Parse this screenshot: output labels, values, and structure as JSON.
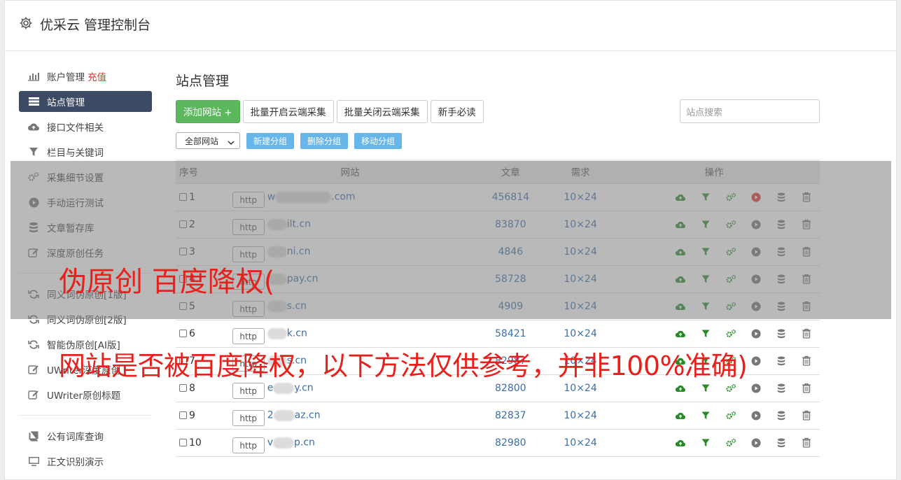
{
  "header": {
    "title": "优采云 管理控制台"
  },
  "sidebar": {
    "items": [
      {
        "label": "账户管理",
        "extra": "充值",
        "icon": "bar-chart-icon"
      },
      {
        "label": "站点管理",
        "icon": "server-icon",
        "active": true
      },
      {
        "label": "接口文件相关",
        "icon": "cloud-upload-icon"
      },
      {
        "label": "栏目与关键词",
        "icon": "filter-icon"
      },
      {
        "label": "采集细节设置",
        "icon": "gears-icon"
      },
      {
        "label": "手动运行测试",
        "icon": "play-circle-icon"
      },
      {
        "label": "文章暂存库",
        "icon": "database-icon"
      },
      {
        "label": "深度原创任务",
        "icon": "edit-icon"
      }
    ],
    "items2": [
      {
        "label": "同义词伪原创[1版]",
        "icon": "refresh-icon"
      },
      {
        "label": "同义词伪原创[2版]",
        "icon": "refresh-icon"
      },
      {
        "label": "智能伪原创[AI版]",
        "icon": "refresh-icon"
      },
      {
        "label": "UWriter深度原创",
        "icon": "edit-icon"
      },
      {
        "label": "UWriter原创标题",
        "icon": "edit-icon"
      }
    ],
    "items3": [
      {
        "label": "公有词库查询",
        "icon": "book-icon"
      },
      {
        "label": "正文识别演示",
        "icon": "monitor-icon"
      }
    ]
  },
  "main": {
    "title": "站点管理",
    "toolbar": {
      "add": "添加网站 +",
      "enable_cloud": "批量开启云端采集",
      "disable_cloud": "批量关闭云端采集",
      "guide": "新手必读",
      "search_placeholder": "站点搜索"
    },
    "group_select": "全部网站",
    "group_buttons": [
      "新建分组",
      "删除分组",
      "移动分组"
    ],
    "table": {
      "headers": [
        "序号",
        "网站",
        "文章",
        "需求",
        "操作"
      ],
      "rows": [
        {
          "num": "1",
          "proto": "http",
          "prefix": "w",
          "suffix": ".com",
          "articles": "456814",
          "demand": "10×24",
          "running": true
        },
        {
          "num": "2",
          "proto": "http",
          "prefix": "",
          "suffix": "ilt.cn",
          "articles": "83870",
          "demand": "10×24"
        },
        {
          "num": "3",
          "proto": "http",
          "prefix": "",
          "suffix": "ni.cn",
          "articles": "4846",
          "demand": "10×24"
        },
        {
          "num": "4",
          "proto": "http",
          "prefix": "",
          "suffix": "pay.cn",
          "articles": "58728",
          "demand": "10×24"
        },
        {
          "num": "5",
          "proto": "http",
          "prefix": "",
          "suffix": "s.cn",
          "articles": "4909",
          "demand": "10×24"
        },
        {
          "num": "6",
          "proto": "http",
          "prefix": "",
          "suffix": "k.cn",
          "articles": "58421",
          "demand": "10×24"
        },
        {
          "num": "7",
          "proto": "http",
          "prefix": "",
          "suffix": "s.cn",
          "articles": "82987",
          "demand": "10×24"
        },
        {
          "num": "8",
          "proto": "http",
          "prefix": "e",
          "suffix": "y.cn",
          "articles": "82800",
          "demand": "10×24"
        },
        {
          "num": "9",
          "proto": "http",
          "prefix": "2",
          "suffix": "az.cn",
          "articles": "82837",
          "demand": "10×24"
        },
        {
          "num": "10",
          "proto": "http",
          "prefix": "v",
          "suffix": "p.cn",
          "articles": "82980",
          "demand": "10×24"
        }
      ]
    }
  },
  "watermark": {
    "line1": "伪原创 百度降权(",
    "line2": "网站是否被百度降权，以下方法仅供参考，并非100%准确)"
  },
  "colors": {
    "accent_green": "#5cb85c",
    "active_nav": "#3d4a63",
    "link_blue": "#3a6eaa",
    "watermark_red": "#e8201b",
    "run_red": "#e0322c"
  }
}
